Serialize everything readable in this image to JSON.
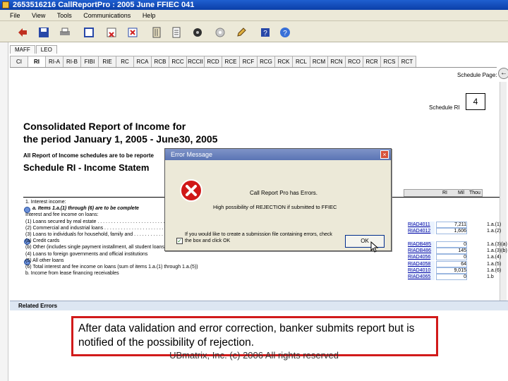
{
  "window": {
    "title": "2653516216   CallReportPro :  2005 June FFIEC 041"
  },
  "menu": [
    "File",
    "View",
    "Tools",
    "Communications",
    "Help"
  ],
  "toolbar_icons": [
    "back-arrow-icon",
    "save-disk-icon",
    "print-icon",
    "blank-page-icon",
    "clear-page-icon",
    "delete-icon",
    "binder-icon",
    "document-list-icon",
    "hardware-icon",
    "disc-icon",
    "edit-pencil-icon",
    "help-book-icon",
    "help-circle-icon"
  ],
  "form_tabs": [
    "MAFF",
    "LEO"
  ],
  "schedule_tabs": [
    "CI",
    "RI",
    "RI-A",
    "RI-B",
    "FIBI",
    "RIE",
    "RC",
    "RCA",
    "RCB",
    "RCC",
    "RCCII",
    "RCD",
    "RCE",
    "RCF",
    "RCG",
    "RCK",
    "RCL",
    "RCM",
    "RCN",
    "RCO",
    "RCR",
    "RCS",
    "RCT"
  ],
  "schedule_pages_label": "Schedule Page:",
  "schedule_label": "Schedule RI",
  "page_number": "4",
  "report_title_1": "Consolidated Report of Income for",
  "report_title_2": "the period January 1, 2005 - June30, 2005",
  "intro_line": "All Report of Income schedules are to be reporte",
  "schedule_title": "Schedule RI - Income Statem",
  "column_headers": [
    "RI",
    "Mil",
    "Thou"
  ],
  "line_items": [
    "1. Interest income:",
    "a.  Items 1.a.(1) through (6) are to be complete",
    "       Interest and fee income on loans:",
    "       (1)  Loans secured by real estate . . . . . . . . . . . . . . . . . . . . . . . . . . . . . . . . . . . . . .",
    "       (2)  Commercial and industrial loans . . . . . . . . . . . . . . . . . . . . . . . . . . . . . . . . . . . .",
    "       (3)  Loans to individuals for household, family and . . . . . . . . . . . . . . . . . . . . . . . . . . . . .",
    "              (a)  Credit cards",
    "              (b)  Other (includes single payment installment, all student loans, and revolving credit plans other than credit cards)",
    "       (4)  Loans to foreign governments and official institutions",
    "       (5)  All other loans",
    "       (6)  Total interest and fee income on loans (sum of items 1.a.(1) through 1.a.(5))",
    "b.  Income from lease financing receivables"
  ],
  "codes": [
    {
      "code": "RIAD4011",
      "value": "7,211"
    },
    {
      "code": "RIAD4012",
      "value": "1,606"
    },
    {
      "code": "",
      "value": ""
    },
    {
      "code": "RIADB485",
      "value": "0"
    },
    {
      "code": "RIADB486",
      "value": "145"
    },
    {
      "code": "RIAD4056",
      "value": "0"
    },
    {
      "code": "RIAD4058",
      "value": "64"
    },
    {
      "code": "RIAD4010",
      "value": "9,015"
    },
    {
      "code": "RIAD4065",
      "value": "0"
    }
  ],
  "refs": [
    "1.a.(1)",
    "1.a.(2)",
    "",
    "1.a.(3)(a)",
    "1.a.(3)(b)",
    "1.a.(4)",
    "1.a.(5)",
    "1.a.(6)",
    "1.b"
  ],
  "related_errors_label": "Related Errors",
  "dialog": {
    "title": "Error Message",
    "message1": "Call Report Pro has Errors.",
    "message2": "High possibility of REJECTION if submitted to FFIEC",
    "checkbox_text": "If you would like to create a submission file containing errors, check the box and click OK",
    "ok_label": "OK"
  },
  "callout_text": "After data validation and error correction, banker submits report but is notified of the possibility of rejection.",
  "footer_text": "UBmatrix, Inc. (c) 2006 All rights reserved"
}
